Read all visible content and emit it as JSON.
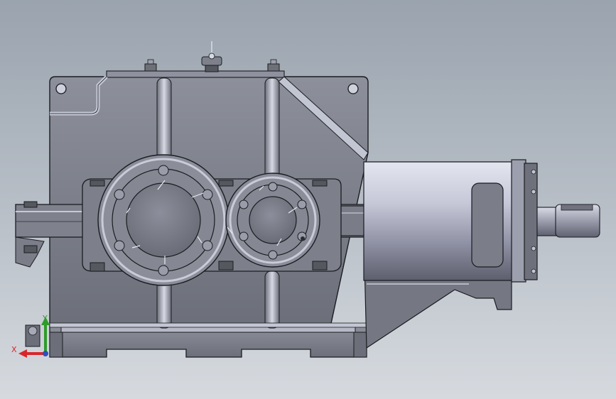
{
  "viewport": {
    "background_top": "#9aa3ae",
    "background_bottom": "#d6dadf"
  },
  "model": {
    "body_color": "#7a7d86",
    "edge_color": "#1a1c20",
    "highlight_color": "#c9ccd8",
    "motor_color": "#b9bccc"
  },
  "triad": {
    "x_label": "X",
    "y_label": "Y",
    "x_color": "#d8262b",
    "y_color": "#2f9b2a",
    "z_color": "#2d4fbf"
  }
}
